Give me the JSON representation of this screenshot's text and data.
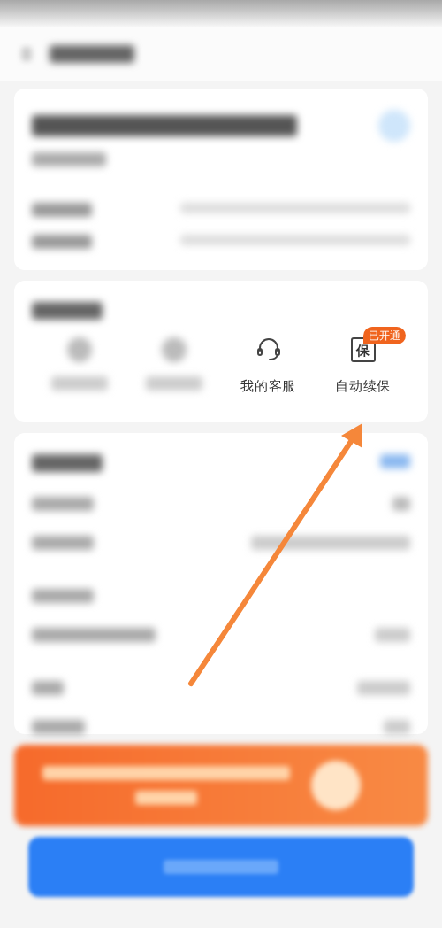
{
  "services": {
    "items": [
      {
        "kind": "blurred"
      },
      {
        "kind": "blurred"
      },
      {
        "kind": "headset",
        "label": "我的客服"
      },
      {
        "kind": "seal",
        "icon_text": "保",
        "label": "自动续保",
        "badge": "已开通"
      }
    ]
  }
}
